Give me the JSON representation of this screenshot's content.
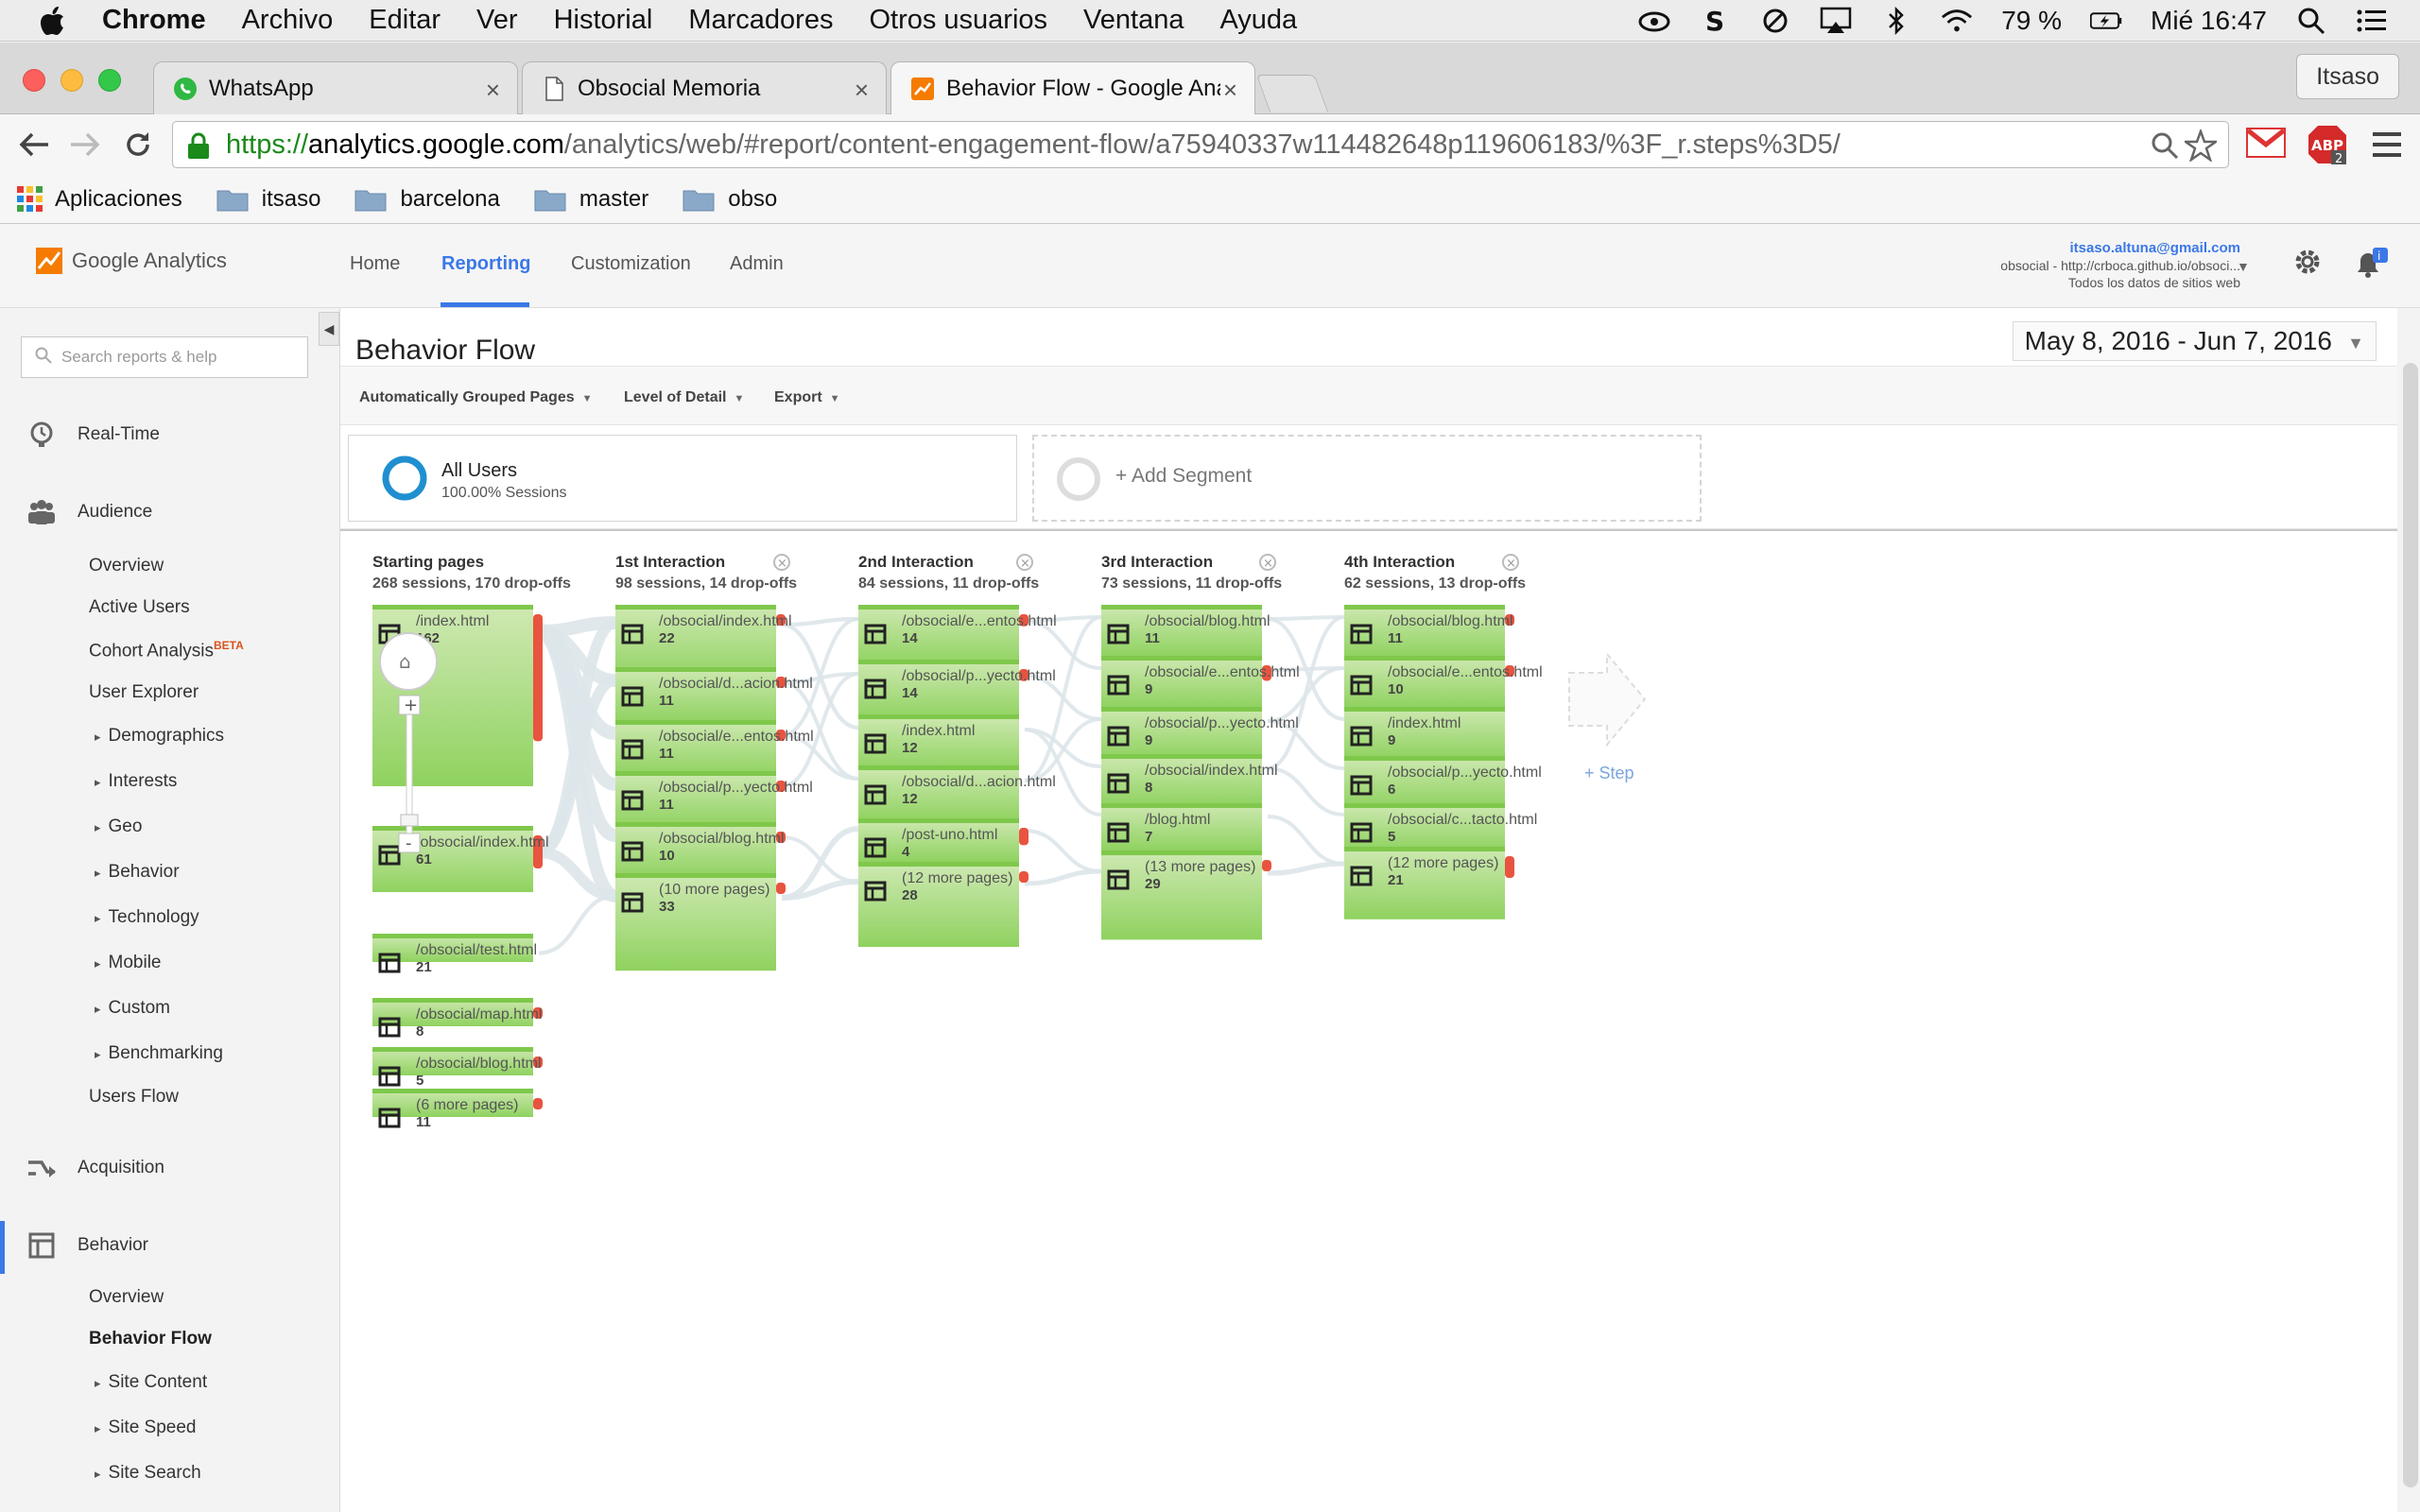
{
  "menubar": {
    "app": "Chrome",
    "items": [
      "Archivo",
      "Editar",
      "Ver",
      "Historial",
      "Marcadores",
      "Otros usuarios",
      "Ventana",
      "Ayuda"
    ],
    "battery": "79 %",
    "clock": "Mié 16:47"
  },
  "tabs": [
    {
      "title": "WhatsApp"
    },
    {
      "title": "Obsocial Memoria"
    },
    {
      "title": "Behavior Flow - Google Ana"
    }
  ],
  "profile": "Itsaso",
  "url": {
    "scheme": "https://",
    "host": "analytics.google.com",
    "path": "/analytics/web/#report/content-engagement-flow/a75940337w114482648p119606183/%3F_r.steps%3D5/"
  },
  "bookmarks": {
    "apps": "Aplicaciones",
    "folders": [
      "itsaso",
      "barcelona",
      "master",
      "obso"
    ]
  },
  "ga": {
    "brand": "Google Analytics",
    "nav": [
      "Home",
      "Reporting",
      "Customization",
      "Admin"
    ],
    "account_email": "itsaso.altuna@gmail.com",
    "account_property": "obsocial - http://crboca.github.io/obsoci...",
    "account_view": "Todos los datos de sitios web"
  },
  "sidebar": {
    "search_placeholder": "Search reports & help",
    "realtime": "Real-Time",
    "audience": "Audience",
    "audience_items": [
      "Overview",
      "Active Users",
      "Cohort Analysis",
      "User Explorer",
      "Demographics",
      "Interests",
      "Geo",
      "Behavior",
      "Technology",
      "Mobile",
      "Custom",
      "Benchmarking",
      "Users Flow"
    ],
    "beta": "BETA",
    "acquisition": "Acquisition",
    "behavior": "Behavior",
    "behavior_items": [
      "Overview",
      "Behavior Flow",
      "Site Content",
      "Site Speed",
      "Site Search"
    ]
  },
  "report": {
    "title": "Behavior Flow",
    "date_range": "May 8, 2016 - Jun 7, 2016",
    "controls": [
      "Automatically Grouped Pages",
      "Level of Detail",
      "Export"
    ],
    "segment_name": "All Users",
    "segment_sub": "100.00% Sessions",
    "add_segment": "+ Add Segment",
    "step_label": "+ Step"
  },
  "flow": {
    "columns": [
      {
        "title": "Starting pages",
        "summary": "268 sessions, 170 drop-offs"
      },
      {
        "title": "1st Interaction",
        "summary": "98 sessions, 14 drop-offs"
      },
      {
        "title": "2nd Interaction",
        "summary": "84 sessions, 11 drop-offs"
      },
      {
        "title": "3rd Interaction",
        "summary": "73 sessions, 11 drop-offs"
      },
      {
        "title": "4th Interaction",
        "summary": "62 sessions, 13 drop-offs"
      }
    ],
    "nodes": [
      [
        {
          "page": "/index.html",
          "sessions": 162,
          "dropoffs": 0.7
        },
        {
          "page": "/obsocial/index.html",
          "sessions": 61,
          "dropoffs": 0.5
        },
        {
          "page": "/obsocial/test.html",
          "sessions": 21,
          "dropoffs": 0
        },
        {
          "page": "/obsocial/map.html",
          "sessions": 8,
          "dropoffs": 0.9
        },
        {
          "page": "/obsocial/blog.html",
          "sessions": 5,
          "dropoffs": 0.6
        },
        {
          "page": "(6 more pages)",
          "sessions": 11,
          "dropoffs": 0.7
        }
      ],
      [
        {
          "page": "/obsocial/index.html",
          "sessions": 22,
          "dropoffs": 0.15
        },
        {
          "page": "/obsocial/d...acion.html",
          "sessions": 11,
          "dropoffs": 0.2
        },
        {
          "page": "/obsocial/e...entos.html",
          "sessions": 11,
          "dropoffs": 0.1
        },
        {
          "page": "/obsocial/p...yecto.html",
          "sessions": 11,
          "dropoffs": 0.2
        },
        {
          "page": "/obsocial/blog.html",
          "sessions": 10,
          "dropoffs": 0.2
        },
        {
          "page": "(10 more pages)",
          "sessions": 33,
          "dropoffs": 0.1
        }
      ],
      [
        {
          "page": "/obsocial/e...entos.html",
          "sessions": 14,
          "dropoffs": 0.2
        },
        {
          "page": "/obsocial/p...yecto.html",
          "sessions": 14,
          "dropoffs": 0.2
        },
        {
          "page": "/index.html",
          "sessions": 12,
          "dropoffs": 0
        },
        {
          "page": "/obsocial/d...acion.html",
          "sessions": 12,
          "dropoffs": 0
        },
        {
          "page": "/post-uno.html",
          "sessions": 4,
          "dropoffs": 0.4
        },
        {
          "page": "(12 more pages)",
          "sessions": 28,
          "dropoffs": 0.1
        }
      ],
      [
        {
          "page": "/obsocial/blog.html",
          "sessions": 11,
          "dropoffs": 0
        },
        {
          "page": "/obsocial/e...entos.html",
          "sessions": 9,
          "dropoffs": 0.3
        },
        {
          "page": "/obsocial/p...yecto.html",
          "sessions": 9,
          "dropoffs": 0
        },
        {
          "page": "/obsocial/index.html",
          "sessions": 8,
          "dropoffs": 0
        },
        {
          "page": "/blog.html",
          "sessions": 7,
          "dropoffs": 0
        },
        {
          "page": "(13 more pages)",
          "sessions": 29,
          "dropoffs": 0.1
        }
      ],
      [
        {
          "page": "/obsocial/blog.html",
          "sessions": 11,
          "dropoffs": 0.2
        },
        {
          "page": "/obsocial/e...entos.html",
          "sessions": 10,
          "dropoffs": 0.2
        },
        {
          "page": "/index.html",
          "sessions": 9,
          "dropoffs": 0
        },
        {
          "page": "/obsocial/p...yecto.html",
          "sessions": 6,
          "dropoffs": 0
        },
        {
          "page": "/obsocial/c...tacto.html",
          "sessions": 5,
          "dropoffs": 0
        },
        {
          "page": "(12 more pages)",
          "sessions": 21,
          "dropoffs": 0.3
        }
      ]
    ]
  },
  "colors": {
    "accent": "#3b78e7",
    "node_green_top": "#cfe9b3",
    "node_green_bottom": "#8fd25f",
    "dropoff_red": "#e8543f",
    "link_fill": "#dde6ea"
  }
}
